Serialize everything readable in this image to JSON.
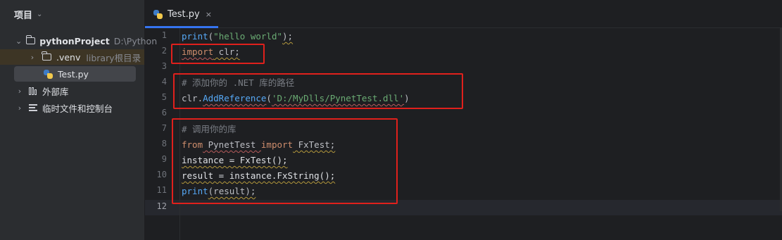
{
  "sidebar": {
    "title": "项目",
    "tree": [
      {
        "label": "pythonProject",
        "sub": "D:\\Python"
      },
      {
        "label": ".venv",
        "sub": "library根目录"
      },
      {
        "label": "Test.py",
        "sub": ""
      },
      {
        "label": "外部库",
        "sub": ""
      },
      {
        "label": "临时文件和控制台",
        "sub": ""
      }
    ]
  },
  "editor": {
    "tab_label": "Test.py",
    "tab_close": "×",
    "line_numbers": [
      "1",
      "2",
      "3",
      "4",
      "5",
      "6",
      "7",
      "8",
      "9",
      "10",
      "11",
      "12"
    ],
    "code": {
      "l1": {
        "fn": "print",
        "open": "(",
        "str": "\"hello world\"",
        "close": ");"
      },
      "l2": {
        "kw": "import",
        "rest": " clr;"
      },
      "l4": {
        "comment": "# 添加你的 .NET 库的路径"
      },
      "l5": {
        "obj": "clr.",
        "fn": "AddReference",
        "open": "(",
        "str": "'D:/MyDlls/PynetTest.dll'",
        "close": ")"
      },
      "l7": {
        "comment": "# 调用你的库"
      },
      "l8": {
        "kw1": "from",
        "mod": " PynetTest ",
        "kw2": "import",
        "rest": " FxTest;"
      },
      "l9": {
        "text": "instance = FxTest();"
      },
      "l10": {
        "text": "result = instance.FxString();"
      },
      "l11": {
        "fn": "print",
        "text": "(result);"
      }
    }
  },
  "colors": {
    "highlight_box": "#e0201c",
    "accent": "#3574f0"
  }
}
